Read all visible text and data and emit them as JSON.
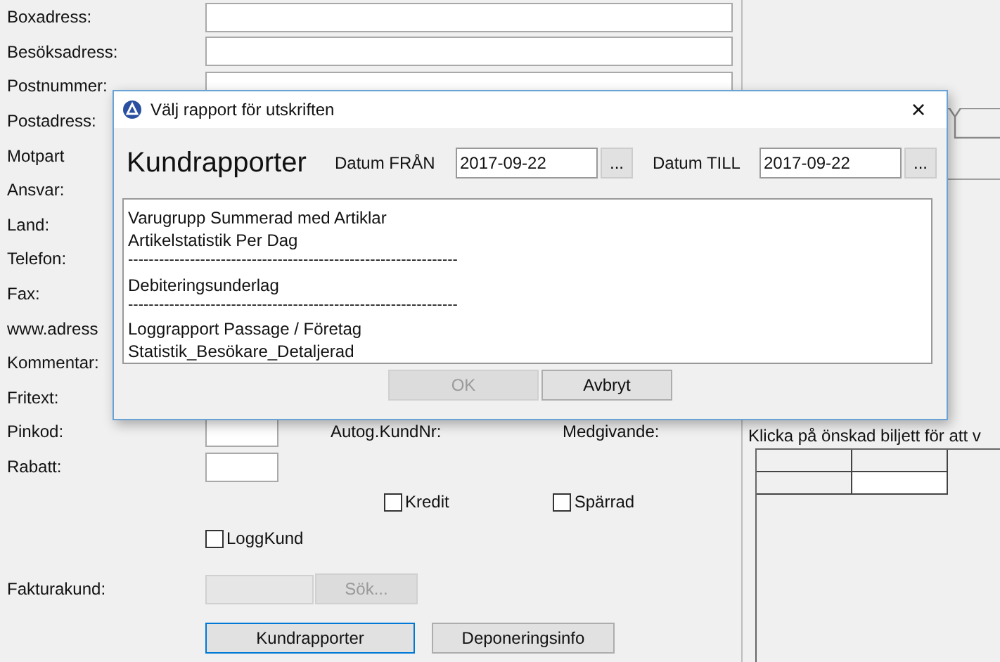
{
  "form": {
    "address_fields": [
      {
        "label": "Boxadress:"
      },
      {
        "label": "Besöksadress:"
      },
      {
        "label": "Postnummer:"
      }
    ],
    "covered_rows": [
      {
        "label": "Postadress:"
      },
      {
        "label": "Motpart"
      },
      {
        "label": "Ansvar:"
      },
      {
        "label": "Land:"
      },
      {
        "label": "Telefon:"
      },
      {
        "label": "Fax:"
      },
      {
        "label": "www.adress"
      },
      {
        "label": "Kommentar:"
      },
      {
        "label": "Fritext:"
      }
    ],
    "pinkod_label": "Pinkod:",
    "autog_label": "Autog.KundNr:",
    "medgivande_label": "Medgivande:",
    "rabatt_label": "Rabatt:",
    "checkboxes": [
      {
        "label": "Kredit",
        "checked": false
      },
      {
        "label": "Spärrad",
        "checked": false
      },
      {
        "label": "LoggKund",
        "checked": false
      }
    ],
    "fakturakund_label": "Fakturakund:",
    "search_button": {
      "label": "Sök...",
      "disabled": true
    },
    "buttons": [
      {
        "label": "Kundrapporter",
        "focused": true
      },
      {
        "label": "Deponeringsinfo",
        "focused": false
      }
    ]
  },
  "right_panel": {
    "hint": "Klicka på önskad biljett för att v"
  },
  "dialog": {
    "title": "Välj rapport för utskriften",
    "close": "×",
    "heading": "Kundrapporter",
    "date_from": {
      "label": "Datum FRÅN",
      "value": "2017-09-22",
      "button": "..."
    },
    "date_to": {
      "label": "Datum TILL",
      "value": "2017-09-22",
      "button": "..."
    },
    "reports": [
      {
        "kind": "item",
        "text": "Varugrupp Summerad med Artiklar",
        "selected": false
      },
      {
        "kind": "item",
        "text": "Artikelstatistik Per Dag",
        "selected": false
      },
      {
        "kind": "separator",
        "text": "----------------------------------------------------------------"
      },
      {
        "kind": "item",
        "text": "Debiteringsunderlag",
        "selected": false
      },
      {
        "kind": "separator",
        "text": "----------------------------------------------------------------"
      },
      {
        "kind": "item",
        "text": "Loggrapport Passage / Företag",
        "selected": false
      },
      {
        "kind": "item",
        "text": "Statistik_Besökare_Detaljerad",
        "selected": false
      }
    ],
    "buttons": [
      {
        "label": "OK",
        "disabled": true
      },
      {
        "label": "Avbryt",
        "disabled": false
      }
    ]
  }
}
